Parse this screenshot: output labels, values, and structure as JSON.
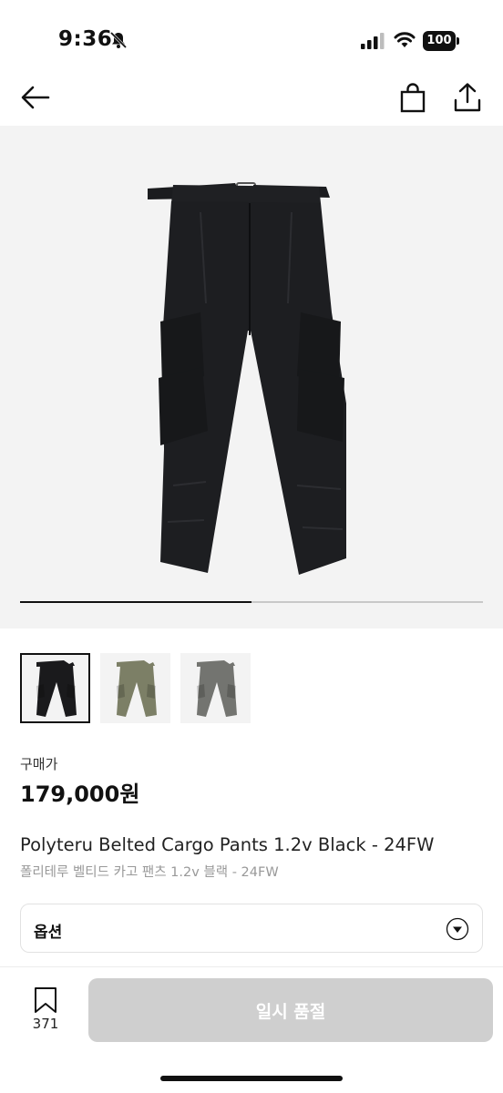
{
  "status_bar": {
    "time": "9:36",
    "battery": "100"
  },
  "gallery": {
    "progress": 0.5,
    "image_count": 2
  },
  "thumbnails": [
    {
      "color": "#1a1a1c",
      "selected": true
    },
    {
      "color": "#7c7f66",
      "selected": false
    },
    {
      "color": "#737470",
      "selected": false
    }
  ],
  "product": {
    "price_label": "구매가",
    "price": "179,000원",
    "name_en": "Polyteru Belted Cargo Pants 1.2v Black - 24FW",
    "name_ko": "폴리테루 벨티드 카고 팬츠 1.2v 블랙 - 24FW"
  },
  "option": {
    "label": "옵션"
  },
  "bottom_bar": {
    "bookmark_count": "371",
    "cta_label": "일시 품절"
  }
}
